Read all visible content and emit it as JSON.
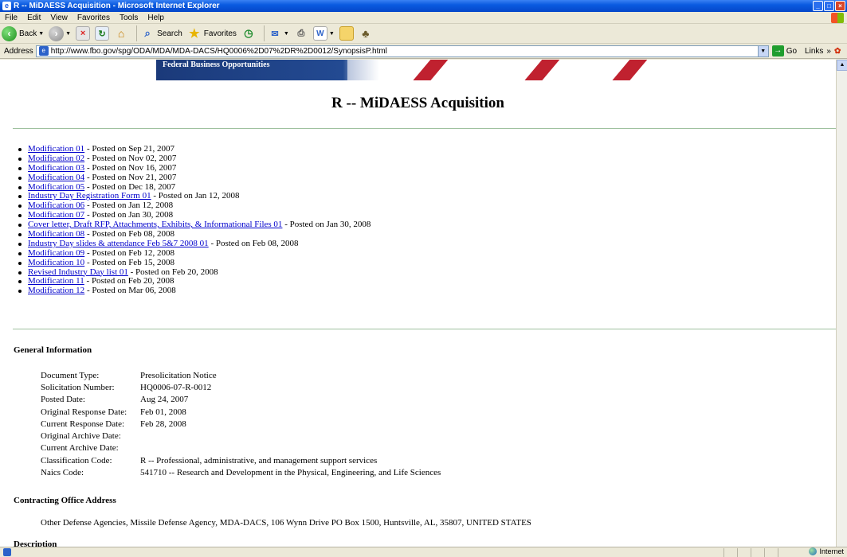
{
  "window": {
    "title": "R -- MiDAESS Acquisition - Microsoft Internet Explorer",
    "app_icon": "ie-icon"
  },
  "menu": [
    "File",
    "Edit",
    "View",
    "Favorites",
    "Tools",
    "Help"
  ],
  "toolbar": {
    "back": "Back",
    "search": "Search",
    "favorites": "Favorites"
  },
  "address": {
    "label": "Address",
    "url": "http://www.fbo.gov/spg/ODA/MDA/MDA-DACS/HQ0006%2D07%2DR%2D0012/SynopsisP.html",
    "go": "Go",
    "links": "Links"
  },
  "banner": {
    "text": "Federal Business Opportunities"
  },
  "page": {
    "title": "R -- MiDAESS Acquisition",
    "modifications": [
      {
        "link": "Modification 01",
        "posted": " - Posted on Sep 21, 2007"
      },
      {
        "link": "Modification 02",
        "posted": " - Posted on Nov 02, 2007"
      },
      {
        "link": "Modification 03",
        "posted": " - Posted on Nov 16, 2007"
      },
      {
        "link": "Modification 04",
        "posted": " - Posted on Nov 21, 2007"
      },
      {
        "link": "Modification 05",
        "posted": " - Posted on Dec 18, 2007"
      },
      {
        "link": "Industry Day Registration Form 01",
        "posted": " - Posted on Jan 12, 2008"
      },
      {
        "link": "Modification 06",
        "posted": " - Posted on Jan 12, 2008"
      },
      {
        "link": "Modification 07",
        "posted": " - Posted on Jan 30, 2008"
      },
      {
        "link": "Cover letter, Draft RFP, Attachments, Exhibits, & Informational Files 01",
        "posted": " - Posted on Jan 30, 2008"
      },
      {
        "link": "Modification 08",
        "posted": " - Posted on Feb 08, 2008"
      },
      {
        "link": "Industry Day slides & attendance Feb 5&7 2008 01",
        "posted": " - Posted on Feb 08, 2008"
      },
      {
        "link": "Modification 09",
        "posted": " - Posted on Feb 12, 2008"
      },
      {
        "link": "Modification 10",
        "posted": " - Posted on Feb 15, 2008"
      },
      {
        "link": "Revised Industry Day list 01",
        "posted": " - Posted on Feb 20, 2008"
      },
      {
        "link": "Modification 11",
        "posted": " - Posted on Feb 20, 2008"
      },
      {
        "link": "Modification 12",
        "posted": " - Posted on Mar 06, 2008"
      }
    ],
    "general_heading": "General Information",
    "general_info": [
      {
        "label": "Document Type:",
        "value": "Presolicitation Notice"
      },
      {
        "label": "Solicitation Number:",
        "value": "HQ0006-07-R-0012"
      },
      {
        "label": "Posted Date:",
        "value": "Aug 24, 2007"
      },
      {
        "label": "Original Response Date:",
        "value": "Feb 01, 2008"
      },
      {
        "label": "Current Response Date:",
        "value": "Feb 28, 2008"
      },
      {
        "label": "Original Archive Date:",
        "value": ""
      },
      {
        "label": "Current Archive Date:",
        "value": ""
      },
      {
        "label": "Classification Code:",
        "value": "R -- Professional, administrative, and management support services"
      },
      {
        "label": "Naics Code:",
        "value": "541710 -- Research and Development in the Physical, Engineering, and Life Sciences"
      }
    ],
    "office_heading": "Contracting Office Address",
    "office_address": "Other Defense Agencies, Missile Defense Agency, MDA-DACS, 106 Wynn Drive PO Box 1500, Huntsville, AL, 35807, UNITED STATES",
    "description_heading": "Description"
  },
  "status": {
    "zone": "Internet"
  }
}
